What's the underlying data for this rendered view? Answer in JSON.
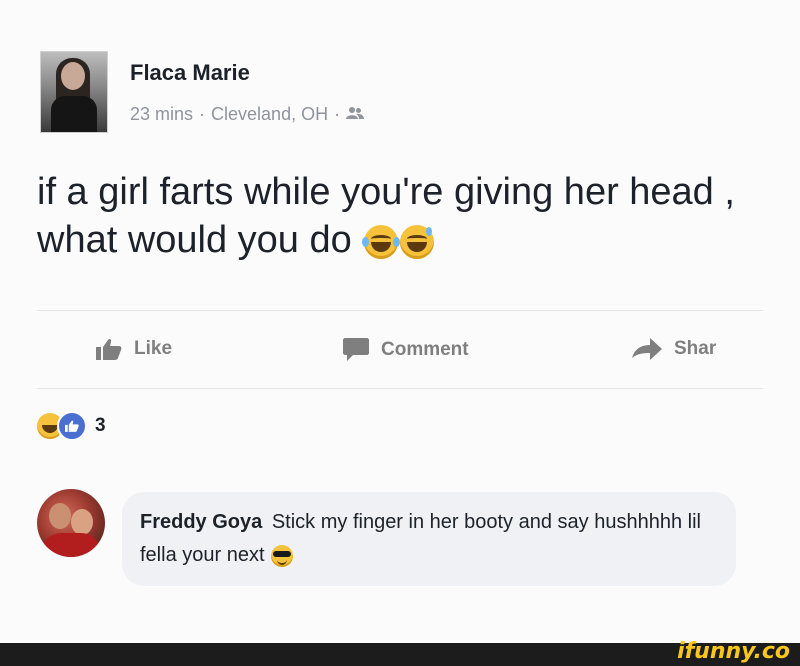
{
  "post": {
    "author": "Flaca Marie",
    "time": "23 mins",
    "location": "Cleveland, OH",
    "privacy_icon": "friends-icon",
    "separator": "·",
    "text": "if a girl farts while you're giving her head , what would you do",
    "text_emojis": [
      "laughing-tears-emoji",
      "grinning-sweat-emoji"
    ]
  },
  "actions": {
    "like_label": "Like",
    "comment_label": "Comment",
    "share_label": "Shar"
  },
  "reactions": {
    "icons": [
      "haha-reaction-icon",
      "like-reaction-icon"
    ],
    "count": "3"
  },
  "comment": {
    "author": "Freddy Goya",
    "text": "Stick my finger in her booty and say hushhhhh lil fella your next",
    "emoji": "sunglasses-emoji"
  },
  "watermark": {
    "brand": "ifunny.co",
    "accent": "#f7c71e"
  },
  "colors": {
    "background": "#fbfbfb",
    "secondary_text": "#90949c",
    "action_gray": "#7f7f7f",
    "like_blue": "#4a6fd0"
  }
}
